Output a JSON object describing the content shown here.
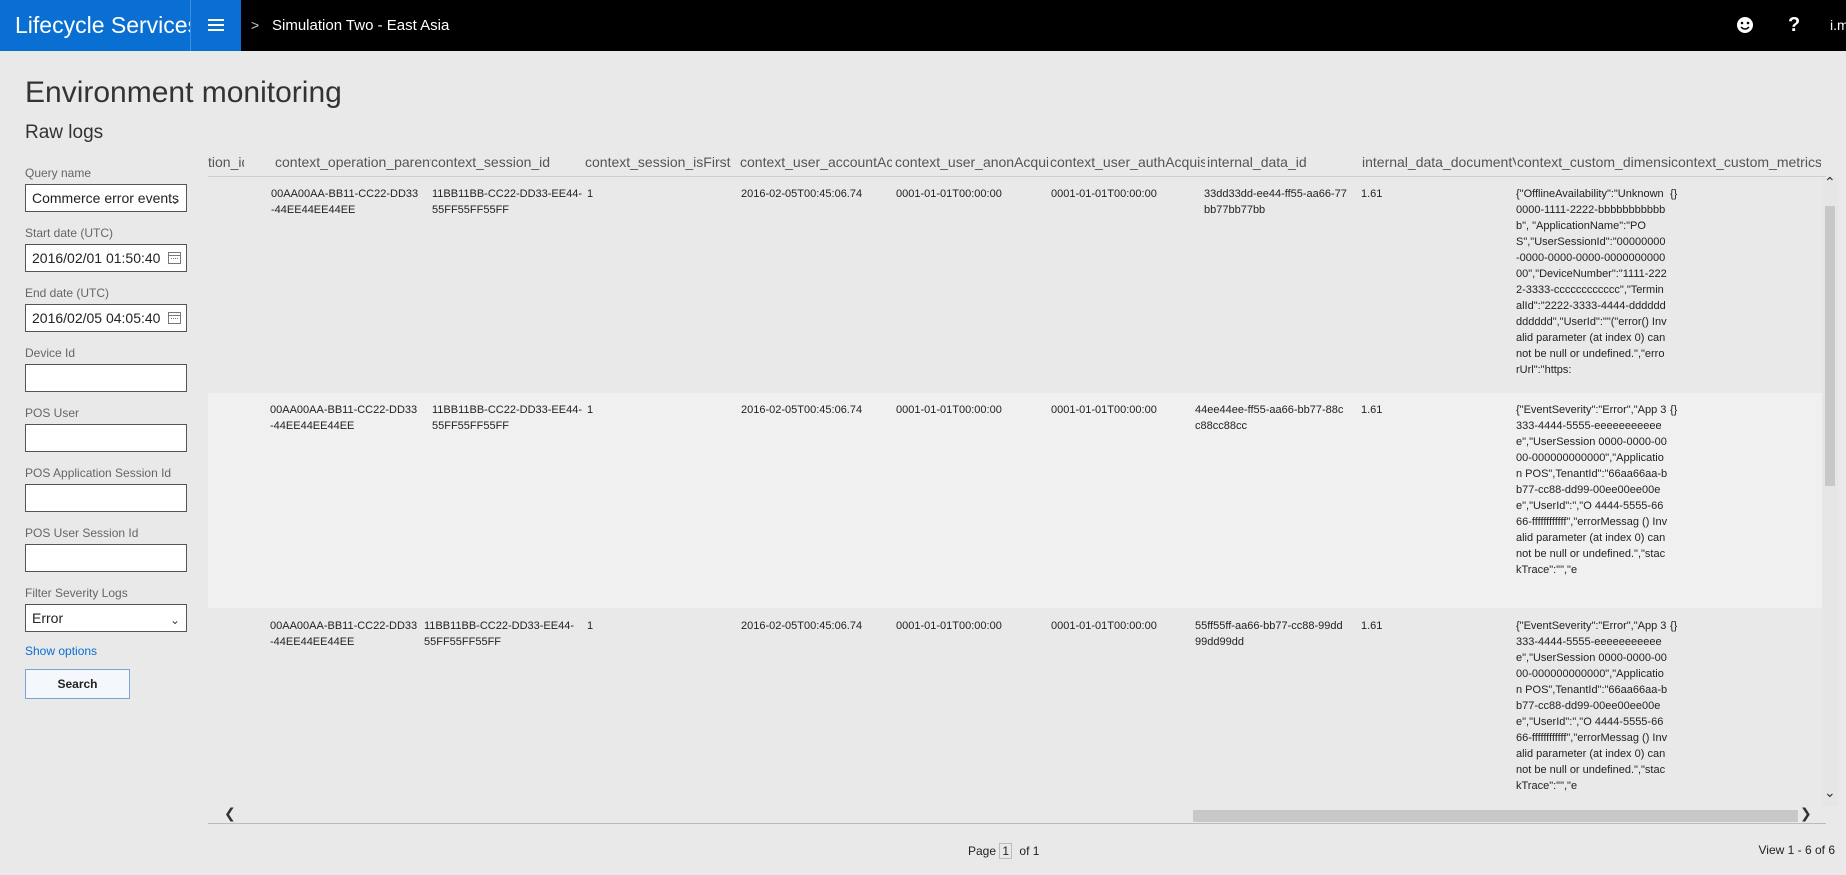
{
  "app": {
    "brand": "Lifecycle Services",
    "breadcrumb_sep": ">",
    "breadcrumb": "Simulation Two - East Asia",
    "help": "?",
    "user": "i.m"
  },
  "page": {
    "title": "Environment monitoring",
    "subtitle": "Raw logs"
  },
  "filters": {
    "query_name_label": "Query name",
    "query_name_value": "Commerce error events",
    "start_label": "Start date (UTC)",
    "start_value": "2016/02/01 01:50:40",
    "end_label": "End date (UTC)",
    "end_value": "2016/02/05 04:05:40",
    "device_label": "Device Id",
    "device_value": "",
    "pos_user_label": "POS User",
    "pos_user_value": "",
    "pos_app_session_label": "POS Application Session Id",
    "pos_app_session_value": "",
    "pos_user_session_label": "POS User Session Id",
    "pos_user_session_value": "",
    "severity_label": "Filter Severity Logs",
    "severity_value": "Error",
    "show_options": "Show options",
    "search": "Search"
  },
  "grid": {
    "columns": [
      "tion_id",
      "context_operation_parent_id",
      "context_session_id",
      "context_session_isFirst",
      "context_user_accountAcquisitionDate",
      "context_user_anonAcquisitionDate",
      "context_user_authAcquisitionDate",
      "internal_data_id",
      "internal_data_documentVersion",
      "context_custom_dimensions",
      "context_custom_metrics"
    ],
    "rows": [
      {
        "parent_id": "00AA00AA-BB11-CC22-DD33-44EE44EE44EE",
        "session_id": "11BB11BB-CC22-DD33-EE44-55FF55FF55FF",
        "is_first": "1",
        "account_date": "2016-02-05T00:45:06.74",
        "anon_date": "0001-01-01T00:00:00",
        "auth_date": "0001-01-01T00:00:00",
        "data_id": "33dd33dd-ee44-ff55-aa66-77bb77bb77bb",
        "doc_version": "1.61",
        "dimensions": "{\"OfflineAvailability\":\"Unknown 0000-1111-2222-bbbbbbbbbbbb\", \"ApplicationName\":\"POS\",\"UserSessionId\":\"00000000-0000-0000-0000-000000000000\",\"DeviceNumber\":\"1111-2222-3333-cccccccccccc\",\"TerminalId\":\"2222-3333-4444-dddddddddddd\",\"UserId\":\"\"(\"error() Invalid parameter (at index 0) cannot be null or undefined.\",\"errorUrl\":\"https:",
        "metrics": "{}"
      },
      {
        "parent_id": "00AA00AA-BB11-CC22-DD33-44EE44EE44EE",
        "session_id": "11BB11BB-CC22-DD33-EE44-55FF55FF55FF",
        "is_first": "1",
        "account_date": "2016-02-05T00:45:06.74",
        "anon_date": "0001-01-01T00:00:00",
        "auth_date": "0001-01-01T00:00:00",
        "data_id": "44ee44ee-ff55-aa66-bb77-88cc88cc88cc",
        "doc_version": "1.61",
        "dimensions": "{\"EventSeverity\":\"Error\",\"App 3333-4444-5555-eeeeeeeeeeee\",\"UserSession 0000-0000-0000-000000000000\",\"Application POS\",TenantId\":\"66aa66aa-bb77-cc88-dd99-00ee00ee00ee\",\"UserId\":\",\"O 4444-5555-6666-ffffffffffff\",\"errorMessag () Invalid parameter (at index 0) cannot be null or undefined.\",\"stackTrace\":\"\",\"e",
        "metrics": "{}"
      },
      {
        "parent_id": "00AA00AA-BB11-CC22-DD33-44EE44EE44EE",
        "session_id": "11BB11BB-CC22-DD33-EE44-55FF55FF55FF",
        "is_first": "1",
        "account_date": "2016-02-05T00:45:06.74",
        "anon_date": "0001-01-01T00:00:00",
        "auth_date": "0001-01-01T00:00:00",
        "data_id": "55ff55ff-aa66-bb77-cc88-99dd99dd99dd",
        "doc_version": "1.61",
        "dimensions": "{\"EventSeverity\":\"Error\",\"App 3333-4444-5555-eeeeeeeeeeee\",\"UserSession 0000-0000-0000-000000000000\",\"Application POS\",TenantId\":\"66aa66aa-bb77-cc88-dd99-00ee00ee00ee\",\"UserId\":\",\"O 4444-5555-6666-ffffffffffff\",\"errorMessag () Invalid parameter (at index 0) cannot be null or undefined.\",\"stackTrace\":\"\",\"e",
        "metrics": "{}"
      }
    ]
  },
  "pager": {
    "label": "Page",
    "current": "1",
    "of": "of 1",
    "view_count": "View 1 - 6 of 6"
  },
  "icons": {
    "menu": "hamburger-icon",
    "feedback": "smiley-icon",
    "help": "question-icon",
    "calendar": "calendar-icon",
    "dropdown": "chevron-down-icon"
  },
  "colors": {
    "brand": "#0a6fd2",
    "topbar": "#000000",
    "background": "#e9e9e9"
  }
}
